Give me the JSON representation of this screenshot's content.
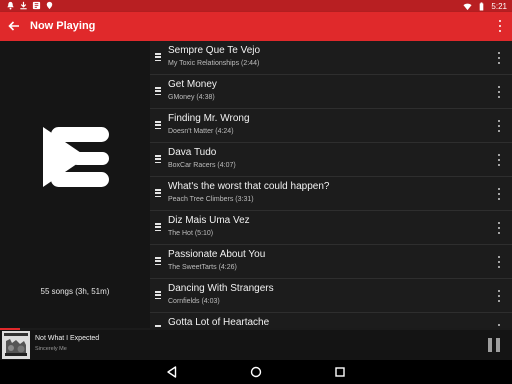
{
  "status_bar": {
    "time": "5:21",
    "left_icons": [
      "notification-bell-icon",
      "download-icon",
      "app-notification-icon",
      "location-pin-icon"
    ],
    "right_icons": [
      "wifi-icon",
      "battery-icon"
    ]
  },
  "app_bar": {
    "title": "Now Playing",
    "back_icon": "back-arrow-icon",
    "overflow_icon": "overflow-menu-icon",
    "color": "#e0292b"
  },
  "left_pane": {
    "logo_icon": "playlist-logo-icon",
    "song_count": "55 songs (3h, 51m)"
  },
  "tracks": [
    {
      "title": "Sempre Que Te Vejo",
      "subtitle": "My Toxic Relationships (2:44)"
    },
    {
      "title": "Get Money",
      "subtitle": "GMoney (4:38)"
    },
    {
      "title": "Finding Mr. Wrong",
      "subtitle": "Doesn't Matter (4:24)"
    },
    {
      "title": "Dava Tudo",
      "subtitle": "BoxCar Racers (4:07)"
    },
    {
      "title": "What's the worst that could happen?",
      "subtitle": "Peach Tree Climbers (3:31)"
    },
    {
      "title": "Diz Mais Uma Vez",
      "subtitle": "The Hot (5:10)"
    },
    {
      "title": "Passionate About You",
      "subtitle": "The SweetTarts (4:26)"
    },
    {
      "title": "Dancing With Strangers",
      "subtitle": "Cornfields (4:03)"
    },
    {
      "title": "Gotta Lot of Heartache",
      "subtitle": ""
    }
  ],
  "now_playing": {
    "title": "Not What I Expected",
    "artist": "Sincerely Me",
    "progress": 0.04,
    "pause_icon": "pause-icon"
  },
  "nav_bar": {
    "icons": [
      "nav-back-icon",
      "nav-home-icon",
      "nav-recents-icon"
    ]
  }
}
